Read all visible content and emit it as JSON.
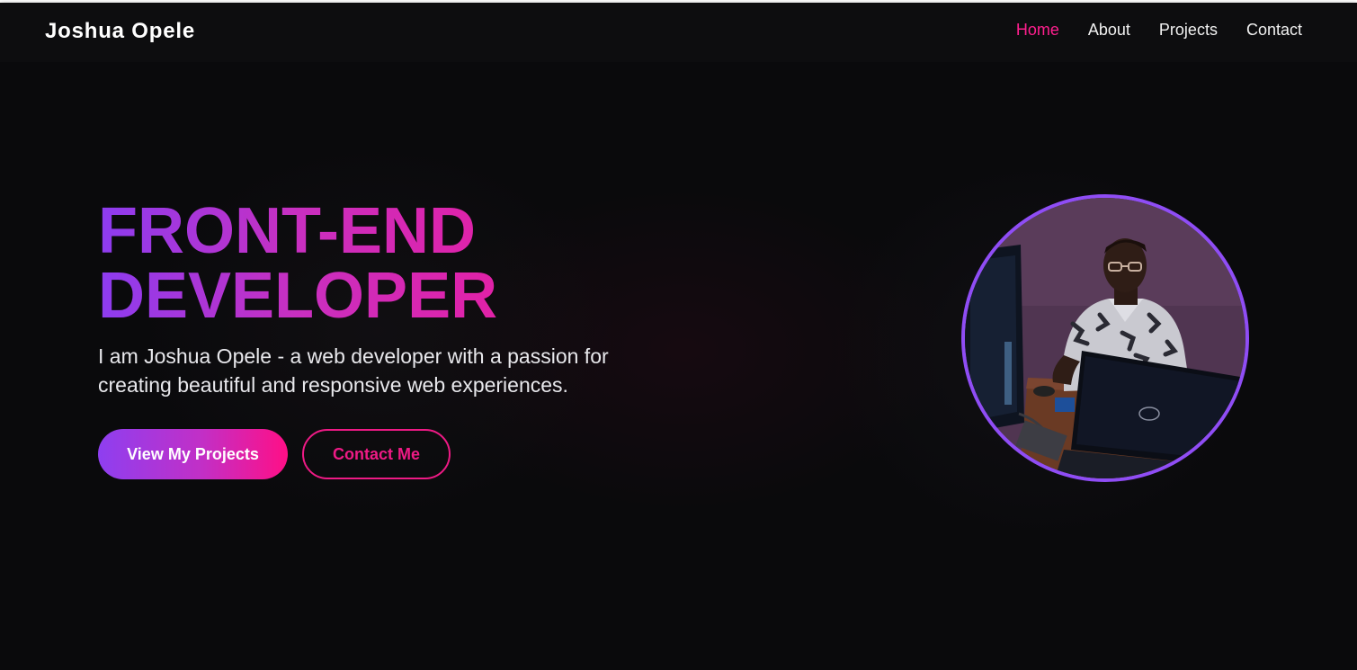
{
  "brand": {
    "name": "Joshua Opele"
  },
  "nav": {
    "items": [
      {
        "label": "Home",
        "active": true
      },
      {
        "label": "About",
        "active": false
      },
      {
        "label": "Projects",
        "active": false
      },
      {
        "label": "Contact",
        "active": false
      }
    ]
  },
  "hero": {
    "headline_line1": "FRONT-END",
    "headline_line2": "DEVELOPER",
    "subtitle": "I am Joshua Opele - a web developer with a passion for creating beautiful and responsive web experiences.",
    "primary_button": "View My Projects",
    "secondary_button": "Contact Me",
    "photo_icon": "profile-photo"
  },
  "colors": {
    "background": "#0a0a0c",
    "accent_pink": "#ee1a85",
    "accent_purple": "#8f4df5",
    "text": "#ffffff"
  }
}
